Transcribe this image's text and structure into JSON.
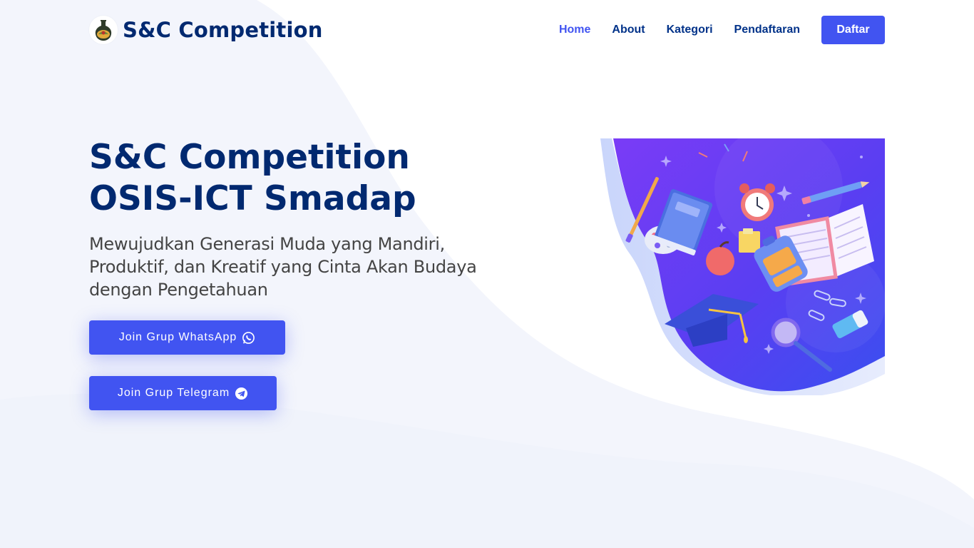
{
  "brand": {
    "name": "S&C Competition",
    "logo_icon": "school-emblem-icon"
  },
  "nav": {
    "items": [
      {
        "label": "Home",
        "active": true
      },
      {
        "label": "About",
        "active": false
      },
      {
        "label": "Kategori",
        "active": false
      },
      {
        "label": "Pendaftaran",
        "active": false
      }
    ],
    "cta_label": "Daftar"
  },
  "hero": {
    "title_line1": "S&C Competition",
    "title_line2": "OSIS-ICT Smadap",
    "subtitle": "Mewujudkan Generasi Muda yang Mandiri, Produktif, dan Kreatif yang Cinta Akan Budaya dengan Pengetahuan",
    "buttons": {
      "whatsapp": {
        "label": "Join Grup WhatsApp",
        "icon": "whatsapp-icon"
      },
      "telegram": {
        "label": "Join Grup Telegram",
        "icon": "telegram-icon"
      }
    },
    "illustration": "education-supplies-illustration"
  },
  "colors": {
    "primary": "#4154f1",
    "heading": "#012970",
    "nav_text": "#013289",
    "body_text": "#444444",
    "bg_tint": "#f3f5fc"
  }
}
